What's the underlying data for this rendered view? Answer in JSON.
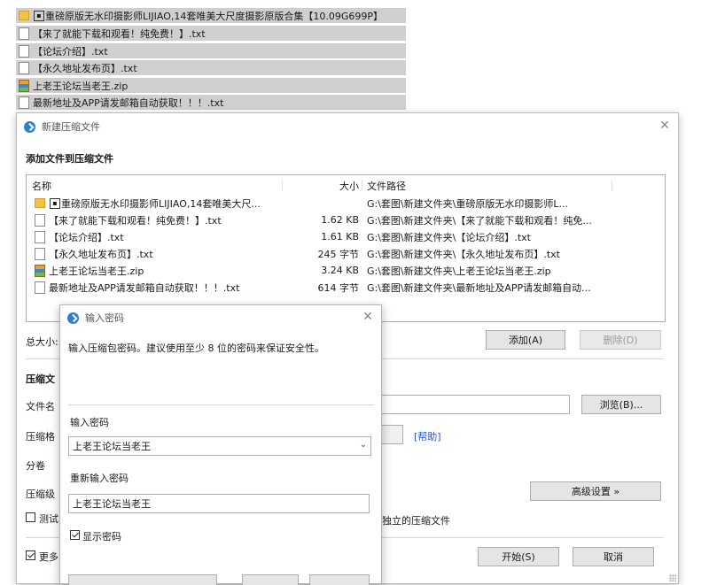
{
  "explorer": {
    "rows": [
      {
        "name": "重磅原版无水印摄影师LIJIAO,14套唯美大尺度摄影原版合集【10.09G699P】",
        "icon": "folder-icon"
      },
      {
        "name": "【来了就能下载和观看！纯免费！】.txt",
        "icon": "text-file-icon"
      },
      {
        "name": "【论坛介绍】.txt",
        "icon": "text-file-icon"
      },
      {
        "name": "【永久地址发布页】.txt",
        "icon": "text-file-icon"
      },
      {
        "name": "上老王论坛当老王.zip",
        "icon": "zip-file-icon"
      },
      {
        "name": "最新地址及APP请发邮箱自动获取！！！.txt",
        "icon": "text-file-icon"
      }
    ]
  },
  "main_window": {
    "title": "新建压缩文件",
    "section_add": "添加文件到压缩文件",
    "list": {
      "headers": {
        "name": "名称",
        "size": "大小",
        "path": "文件路径"
      },
      "rows": [
        {
          "name": "重磅原版无水印摄影师LIJIAO,14套唯美大尺...",
          "size": "",
          "path": "G:\\套图\\新建文件夹\\重磅原版无水印摄影师L...",
          "icon": "folder-icon"
        },
        {
          "name": "【来了就能下载和观看！纯免费！】.txt",
          "size": "1.62 KB",
          "path": "G:\\套图\\新建文件夹\\【来了就能下载和观看！纯免...",
          "icon": "text-file-icon"
        },
        {
          "name": "【论坛介绍】.txt",
          "size": "1.61 KB",
          "path": "G:\\套图\\新建文件夹\\【论坛介绍】.txt",
          "icon": "text-file-icon"
        },
        {
          "name": "【永久地址发布页】.txt",
          "size": "245 字节",
          "path": "G:\\套图\\新建文件夹\\【永久地址发布页】.txt",
          "icon": "text-file-icon"
        },
        {
          "name": "上老王论坛当老王.zip",
          "size": "3.24 KB",
          "path": "G:\\套图\\新建文件夹\\上老王论坛当老王.zip",
          "icon": "zip-file-icon"
        },
        {
          "name": "最新地址及APP请发邮箱自动获取！！！.txt",
          "size": "614 字节",
          "path": "G:\\套图\\新建文件夹\\最新地址及APP请发邮箱自动...",
          "icon": "text-file-icon"
        }
      ]
    },
    "total_size_label": "总大小:",
    "add_button": "添加(A)",
    "delete_button": "删除(D)",
    "section_archive": "压缩文",
    "filename_label": "文件名",
    "browse_button": "浏览(B)...",
    "format_label": "压缩格",
    "help_link": "[帮助]",
    "split_label": "分卷",
    "level_label": "压缩级",
    "advanced_button": "高级设置 »",
    "test_checkbox_label": "测试",
    "independent_text": "独立的压缩文件",
    "more_checkbox_label": "更多",
    "start_button": "开始(S)",
    "cancel_button": "取消"
  },
  "password_dialog": {
    "title": "输入密码",
    "instruction": "输入压缩包密码。建议使用至少 8 位的密码来保证安全性。",
    "password_label": "输入密码",
    "password_value": "上老王论坛当老王",
    "reenter_label": "重新输入密码",
    "reenter_value": "上老王论坛当老王",
    "show_password_label": "显示密码",
    "show_password_checked": true
  },
  "colors": {
    "accent": "#2a7fd4",
    "link": "#2a55c4",
    "selection": "#cfcfcf"
  }
}
